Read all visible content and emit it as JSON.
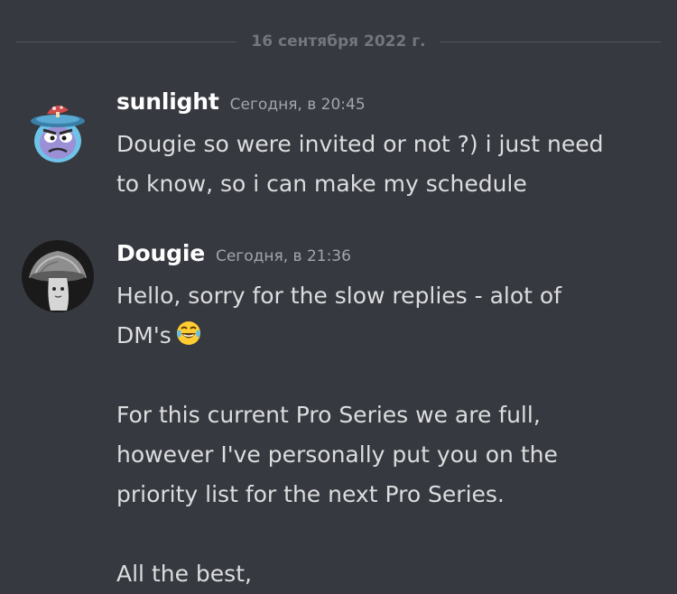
{
  "date_divider": "16 сентября 2022 г.",
  "messages": [
    {
      "avatar_icon": "mushroom-avatar-1",
      "username": "sunlight",
      "timestamp": "Сегодня, в 20:45",
      "lines": [
        "Dougie so were invited or not ?) i just need",
        "to know, so i can make my schedule"
      ]
    },
    {
      "avatar_icon": "mushroom-avatar-2",
      "username": "Dougie",
      "timestamp": "Сегодня, в 21:36",
      "lines": [
        "Hello, sorry for the slow replies - alot of",
        "DM's",
        "",
        "For this current Pro Series we are full,",
        "however I've personally put you on the",
        "priority list for the next Pro Series.",
        "",
        "All the best,"
      ],
      "emoji": "😂"
    }
  ],
  "colors": {
    "background": "#36393f",
    "divider_line": "#4f545c",
    "divider_text": "#72767d",
    "username": "#ffffff",
    "timestamp": "#a3a6aa",
    "message_text": "#dcddde"
  }
}
